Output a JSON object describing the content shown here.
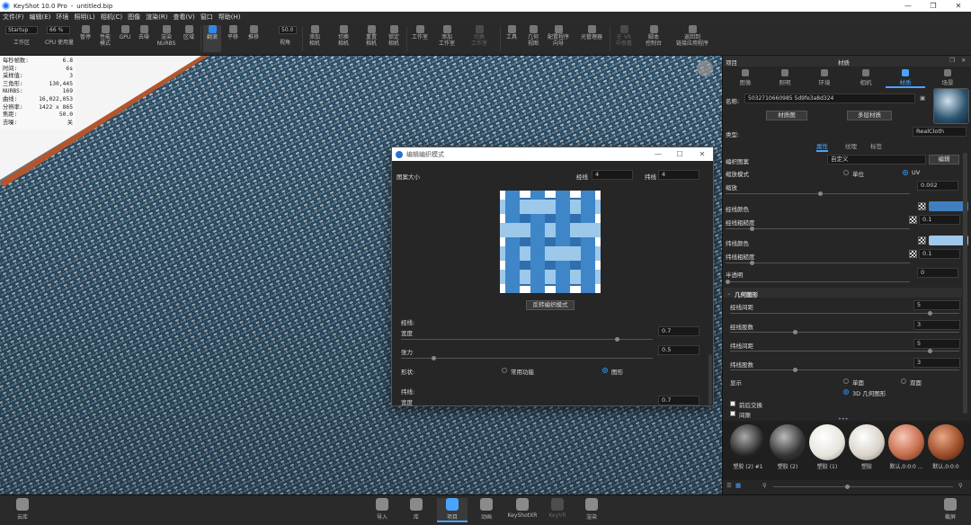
{
  "title": {
    "app": "KeyShot 10.0 Pro",
    "sep": "-",
    "file": "untitled.bip",
    "min": "—",
    "max": "❐",
    "close": "✕"
  },
  "menu": [
    "文件(F)",
    "编辑(E)",
    "环境",
    "照明(L)",
    "相机(C)",
    "图像",
    "渲染(R)",
    "查看(V)",
    "窗口",
    "帮助(H)"
  ],
  "toolbar": {
    "workspace_value": "Startup",
    "zoom_value": "66 %",
    "fov_value": "50.0",
    "items": {
      "workspace": "工作区",
      "cpu": "CPU 使用量",
      "pause": "暂停",
      "perf": "性能\n模式",
      "gpu": "GPU",
      "denoise": "去噪",
      "render": "渲染\nNURBS",
      "region": "区域",
      "tumble": "翻滚",
      "pan": "平移",
      "dolly": "推移",
      "fov": "视角",
      "add_camera": "添加\n相机",
      "switch_camera": "切换\n相机",
      "reset_camera": "重置\n相机",
      "lock_camera": "锁定\n相机",
      "studio": "工作室",
      "add_studio": "添加\n工作室",
      "switch_studio": "切换\n工作室",
      "tools": "工具",
      "geometry_view": "几何\n视图",
      "configurator": "配置程序\n向导",
      "light_manager": "光管理器",
      "vr": "在 VR\n中查看",
      "script": "脚本\n控制台",
      "back": "返回到\n链接应用程序"
    }
  },
  "stats": [
    [
      "每秒帧数:",
      "6.8"
    ],
    [
      "时间:",
      "6s"
    ],
    [
      "采样值:",
      "3"
    ],
    [
      "三角形:",
      "130,445"
    ],
    [
      "NURBS:",
      "169"
    ],
    [
      "曲线:",
      "16,022,053"
    ],
    [
      "分辨率:",
      "1422 x 865"
    ],
    [
      "焦距:",
      "50.0"
    ],
    [
      "去噪:",
      "关"
    ]
  ],
  "dialog": {
    "title": "编辑编织模式",
    "pattern_size": "图案大小",
    "warp_label": "经线",
    "warp_value": "4",
    "weft_label": "纬线",
    "weft_value": "4",
    "reverse_button": "反转编织模式",
    "warp_section": "经线:",
    "width_label": "宽度",
    "width_value": "0.7",
    "tension_label": "张力",
    "tension_value": "0.5",
    "shape_label": "形状:",
    "shape_option1": "常用功能",
    "shape_option2": "图形",
    "weft_section": "纬线:",
    "weft_width_label": "宽度",
    "weft_width_value": "0.7",
    "min": "—",
    "max": "☐",
    "close": "✕"
  },
  "panel": {
    "header_left": "项目",
    "header_center": "材质",
    "tabs": [
      "图像",
      "照明",
      "环境",
      "相机",
      "材质",
      "场景"
    ],
    "name_label": "名称:",
    "name_value": "5032710660985 5d9fe3a8d324",
    "material_graph": "材质图",
    "multi_material": "多层材质",
    "type_label": "类型:",
    "type_value": "RealCloth",
    "subtabs": [
      "属性",
      "纹理",
      "标签"
    ],
    "props": {
      "weave_pattern": "编织图案",
      "weave_pattern_value": "自定义",
      "edit": "编辑",
      "scale_mode": "缩放模式",
      "unit": "单位",
      "uv": "UV",
      "scale": "缩放",
      "scale_value": "0.002",
      "warp_color": "经线颜色",
      "warp_roughness": "经线粗糙度",
      "warp_roughness_value": "0.1",
      "weft_color": "纬线颜色",
      "weft_roughness": "纬线粗糙度",
      "weft_roughness_value": "0.1",
      "transparency": "半透明",
      "transparency_value": "0",
      "geometry_section": "几何图形",
      "warp_spacing": "经线间距",
      "warp_spacing_value": "5",
      "warp_plies": "经线股数",
      "warp_plies_value": "3",
      "weft_spacing": "纬线间距",
      "weft_spacing_value": "5",
      "weft_plies": "纬线股数",
      "weft_plies_value": "3",
      "display": "显示",
      "single": "单面",
      "double": "双面",
      "show_3d": "3D 几何图形",
      "post_swap": "前后交换",
      "gap": "间隙",
      "warp_color_hex": "#3f7fbf",
      "weft_color_hex": "#9fc8ea"
    },
    "thumbs": [
      {
        "label": "塑胶 (2) #1",
        "color": "#444"
      },
      {
        "label": "塑胶 (2)",
        "color": "#555"
      },
      {
        "label": "塑胶 (1)",
        "color": "#eee"
      },
      {
        "label": "塑胶",
        "color": "#ddd"
      },
      {
        "label": "默认,0:0:0 ...",
        "color": "#c87050"
      },
      {
        "label": "默认,0:0:0",
        "color": "#a0502c"
      }
    ],
    "more": "•••"
  },
  "bottom": {
    "cloud": "云库",
    "import": "导入",
    "library": "库",
    "project": "项目",
    "animation": "动画",
    "keyshotxr": "KeyShotXR",
    "keyvr": "KeyVR",
    "render": "渲染",
    "screenshot": "截屏"
  }
}
